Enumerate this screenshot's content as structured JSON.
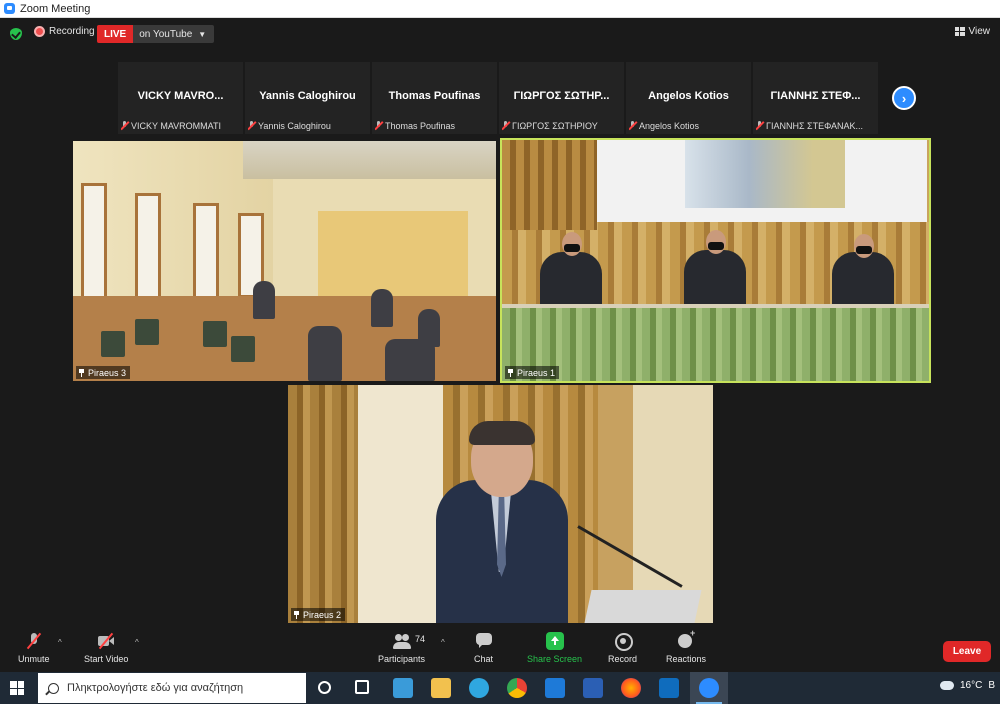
{
  "window": {
    "title": "Zoom Meeting"
  },
  "top_bar": {
    "recording_label": "Recording",
    "live_badge": "LIVE",
    "live_target": "on YouTube",
    "view_label": "View"
  },
  "thumbnails": [
    {
      "display": "VICKY MAVRO...",
      "full": "VICKY MAVROMMATI"
    },
    {
      "display": "Yannis Caloghirou",
      "full": "Yannis Caloghirou"
    },
    {
      "display": "Thomas Poufinas",
      "full": "Thomas Poufinas"
    },
    {
      "display": "ΓΙΩΡΓΟΣ ΣΩΤΗΡ...",
      "full": "ΓΙΩΡΓΟΣ ΣΩΤΗΡΙΟΥ"
    },
    {
      "display": "Angelos Kotios",
      "full": "Angelos Kotios"
    },
    {
      "display": "ΓΙΑΝΝΗΣ ΣΤΕΦ...",
      "full": "ΓΙΑΝΝΗΣ ΣΤΕΦΑΝΑΚ..."
    }
  ],
  "video_tiles": [
    {
      "label": "Piraeus 3"
    },
    {
      "label": "Piraeus 1"
    },
    {
      "label": "Piraeus 2"
    }
  ],
  "toolbar": {
    "unmute": "Unmute",
    "start_video": "Start Video",
    "participants": "Participants",
    "participants_count": "74",
    "chat": "Chat",
    "share_screen": "Share Screen",
    "record": "Record",
    "reactions": "Reactions",
    "leave": "Leave"
  },
  "taskbar": {
    "search_placeholder": "Πληκτρολογήστε εδώ για αναζήτηση",
    "temperature": "16°C",
    "tray_partial": "B"
  },
  "colors": {
    "zoom_blue": "#2d8cff",
    "live_red": "#e02828",
    "active_speaker_border": "#c7e35b",
    "share_green": "#27c24c"
  }
}
